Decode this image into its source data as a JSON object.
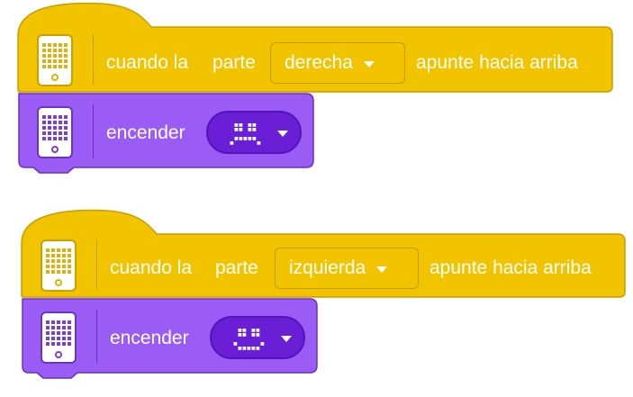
{
  "colors": {
    "event_block": "#f2c400",
    "event_border": "#c99c00",
    "action_block": "#9a5cf4",
    "action_border": "#6a30c0",
    "pill": "#6a1fd6",
    "text": "#ffffff"
  },
  "icons": {
    "hub": "hub-icon",
    "dropdown": "caret-down-icon"
  },
  "scripts": [
    {
      "event": {
        "label_when": "cuando la",
        "label_part": "parte",
        "direction_value": "derecha",
        "label_rest": "apunte hacia arriba"
      },
      "action": {
        "label": "encender",
        "image_pattern": [
          "0000000",
          "0110110",
          "0110110",
          "0000000",
          "0111110",
          "1000001"
        ]
      }
    },
    {
      "event": {
        "label_when": "cuando la",
        "label_part": "parte",
        "direction_value": "izquierda",
        "label_rest": "apunte hacia arriba"
      },
      "action": {
        "label": "encender",
        "image_pattern": [
          "0000000",
          "0110110",
          "0110110",
          "0000000",
          "1000001",
          "0111110"
        ]
      }
    }
  ]
}
